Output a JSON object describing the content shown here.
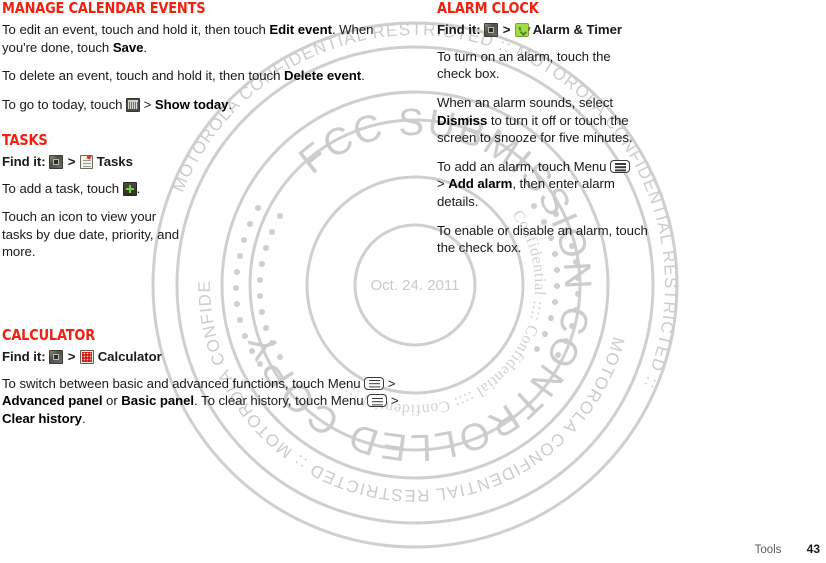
{
  "document": {
    "footer": {
      "section_label": "Tools",
      "page_number": "43"
    }
  },
  "watermark": {
    "center_date": "Oct. 24. 2011",
    "outer_ring_text": "MOTOROLA CONFIDENTIAL RESTRICTED :: MOTOROLA CONFIDENTIAL RESTRICTED :: ",
    "mid_ring_text": "FCC SUBMISSION CONTROLLED COPY",
    "inner_ring_text": "Confidential :::: Confidential :::: Confidential :::: ",
    "color": "#c9c9c9"
  },
  "left_column": {
    "sections": [
      {
        "id": "manage-calendar-events",
        "title": "Manage calendar events",
        "paragraphs": [
          {
            "id": "edit-event",
            "parts": [
              {
                "type": "text",
                "value": "To edit an event, touch and hold it, then touch "
              },
              {
                "type": "bold",
                "value": "Edit event"
              },
              {
                "type": "text",
                "value": ". When you're done, touch "
              },
              {
                "type": "bold",
                "value": "Save"
              },
              {
                "type": "text",
                "value": "."
              }
            ]
          },
          {
            "id": "delete-event",
            "parts": [
              {
                "type": "text",
                "value": "To delete an event, touch and hold it, then touch "
              },
              {
                "type": "bold",
                "value": "Delete event"
              },
              {
                "type": "text",
                "value": "."
              }
            ]
          },
          {
            "id": "go-to-today",
            "parts": [
              {
                "type": "text",
                "value": "To go to today, touch "
              },
              {
                "type": "icon",
                "value": "calendar-icon"
              },
              {
                "type": "text",
                "value": " > "
              },
              {
                "type": "bold",
                "value": "Show today"
              },
              {
                "type": "text",
                "value": "."
              }
            ]
          }
        ]
      },
      {
        "id": "tasks",
        "title": "Tasks",
        "find_it": {
          "label": "Find it:",
          "apps_icon": "apps-icon",
          "separator": ">",
          "app_icon": "tasks-icon",
          "app_label": "Tasks"
        },
        "paragraphs": [
          {
            "id": "add-task",
            "parts": [
              {
                "type": "text",
                "value": "To add a task, touch "
              },
              {
                "type": "icon",
                "value": "add-icon"
              },
              {
                "type": "text",
                "value": "."
              }
            ]
          },
          {
            "id": "view-tasks",
            "parts": [
              {
                "type": "text",
                "value": "Touch an icon to view your tasks by due date, priority, and more."
              }
            ]
          }
        ]
      },
      {
        "id": "calculator",
        "title": "Calculator",
        "find_it": {
          "label": "Find it:",
          "apps_icon": "apps-icon",
          "separator": ">",
          "app_icon": "calculator-icon",
          "app_label": "Calculator"
        },
        "paragraphs": [
          {
            "id": "switch-panels",
            "parts": [
              {
                "type": "text",
                "value": "To switch between basic and advanced functions, touch Menu "
              },
              {
                "type": "icon",
                "value": "menu-icon"
              },
              {
                "type": "text",
                "value": " > "
              },
              {
                "type": "bold",
                "value": "Advanced panel"
              },
              {
                "type": "text",
                "value": " or "
              },
              {
                "type": "bold",
                "value": "Basic panel"
              },
              {
                "type": "text",
                "value": ". To clear history, touch Menu "
              },
              {
                "type": "icon",
                "value": "menu-icon"
              },
              {
                "type": "text",
                "value": " > "
              },
              {
                "type": "bold",
                "value": "Clear history"
              },
              {
                "type": "text",
                "value": "."
              }
            ]
          }
        ]
      }
    ]
  },
  "right_column": {
    "sections": [
      {
        "id": "alarm-clock",
        "title": "Alarm clock",
        "find_it": {
          "label": "Find it:",
          "apps_icon": "apps-icon",
          "separator": ">",
          "app_icon": "alarm-timer-icon",
          "app_label": "Alarm & Timer"
        },
        "paragraphs": [
          {
            "id": "turn-on-alarm",
            "parts": [
              {
                "type": "text",
                "value": "To turn on an alarm, touch the check box."
              }
            ]
          },
          {
            "id": "alarm-sounds",
            "parts": [
              {
                "type": "text",
                "value": "When an alarm sounds, select "
              },
              {
                "type": "bold",
                "value": "Dismiss"
              },
              {
                "type": "text",
                "value": " to turn it off or touch the screen to snooze for five minutes."
              }
            ]
          },
          {
            "id": "add-alarm",
            "parts": [
              {
                "type": "text",
                "value": "To add an alarm, touch Menu "
              },
              {
                "type": "icon",
                "value": "menu-icon"
              },
              {
                "type": "text",
                "value": " > "
              },
              {
                "type": "bold",
                "value": "Add alarm"
              },
              {
                "type": "text",
                "value": ", then enter alarm details."
              }
            ]
          },
          {
            "id": "enable-disable-alarm",
            "parts": [
              {
                "type": "text",
                "value": "To enable or disable an alarm, touch the check box."
              }
            ]
          }
        ]
      }
    ]
  }
}
